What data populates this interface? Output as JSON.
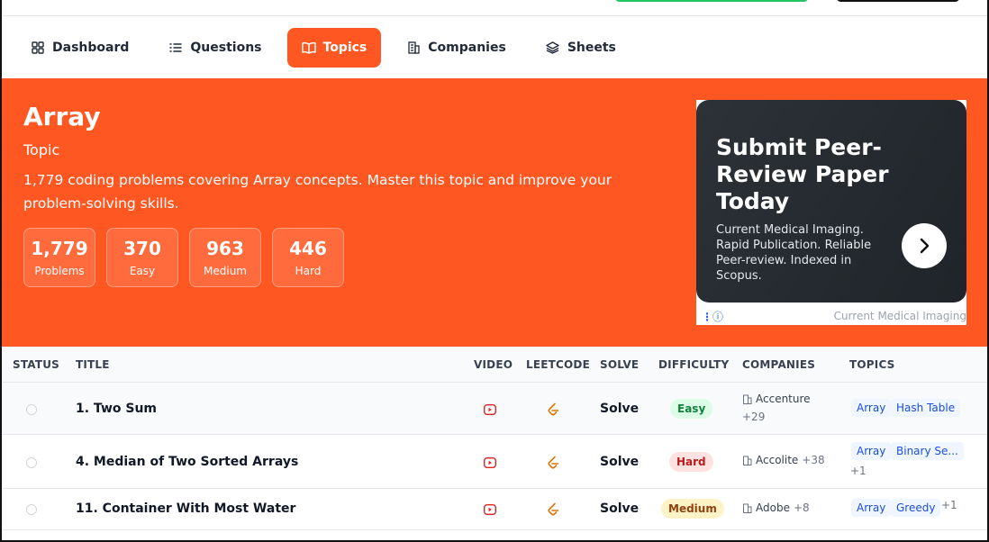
{
  "nav": {
    "items": [
      {
        "label": "Dashboard",
        "icon": "dashboard-icon",
        "active": false
      },
      {
        "label": "Questions",
        "icon": "list-icon",
        "active": false
      },
      {
        "label": "Topics",
        "icon": "book-icon",
        "active": true
      },
      {
        "label": "Companies",
        "icon": "building-icon",
        "active": false
      },
      {
        "label": "Sheets",
        "icon": "layers-icon",
        "active": false
      }
    ]
  },
  "hero": {
    "title": "Array",
    "subtitle": "Topic",
    "description": "1,779 coding problems covering Array concepts. Master this topic and improve your problem-solving skills.",
    "stats": [
      {
        "value": "1,779",
        "label": "Problems"
      },
      {
        "value": "370",
        "label": "Easy"
      },
      {
        "value": "963",
        "label": "Medium"
      },
      {
        "value": "446",
        "label": "Hard"
      }
    ]
  },
  "ad": {
    "title": "Submit Peer-Review Paper Today",
    "text": "Current Medical Imaging. Rapid Publication. Reliable Peer-review. Indexed in Scopus.",
    "source": "Current Medical Imaging"
  },
  "table": {
    "headers": {
      "status": "STATUS",
      "title": "TITLE",
      "video": "VIDEO",
      "leetcode": "LEETCODE",
      "solve": "SOLVE",
      "difficulty": "DIFFICULTY",
      "companies": "COMPANIES",
      "topics": "TOPICS"
    },
    "rows": [
      {
        "title": "1. Two Sum",
        "solve": "Solve",
        "difficulty": "Easy",
        "company": "Accenture",
        "company_more": "+29",
        "topics": [
          "Array",
          "Hash Table"
        ],
        "topics_more": ""
      },
      {
        "title": "4. Median of Two Sorted Arrays",
        "solve": "Solve",
        "difficulty": "Hard",
        "company": "Accolite",
        "company_more": "+38",
        "topics": [
          "Array",
          "Binary Se..."
        ],
        "topics_more": "+1"
      },
      {
        "title": "11. Container With Most Water",
        "solve": "Solve",
        "difficulty": "Medium",
        "company": "Adobe",
        "company_more": "+8",
        "topics": [
          "Array",
          "Greedy"
        ],
        "topics_more": "+1"
      }
    ]
  },
  "colors": {
    "brand": "#ff5722",
    "easy": "#15803d",
    "hard": "#b91c1c",
    "medium": "#92400e",
    "tag": "#1d4ed8"
  }
}
